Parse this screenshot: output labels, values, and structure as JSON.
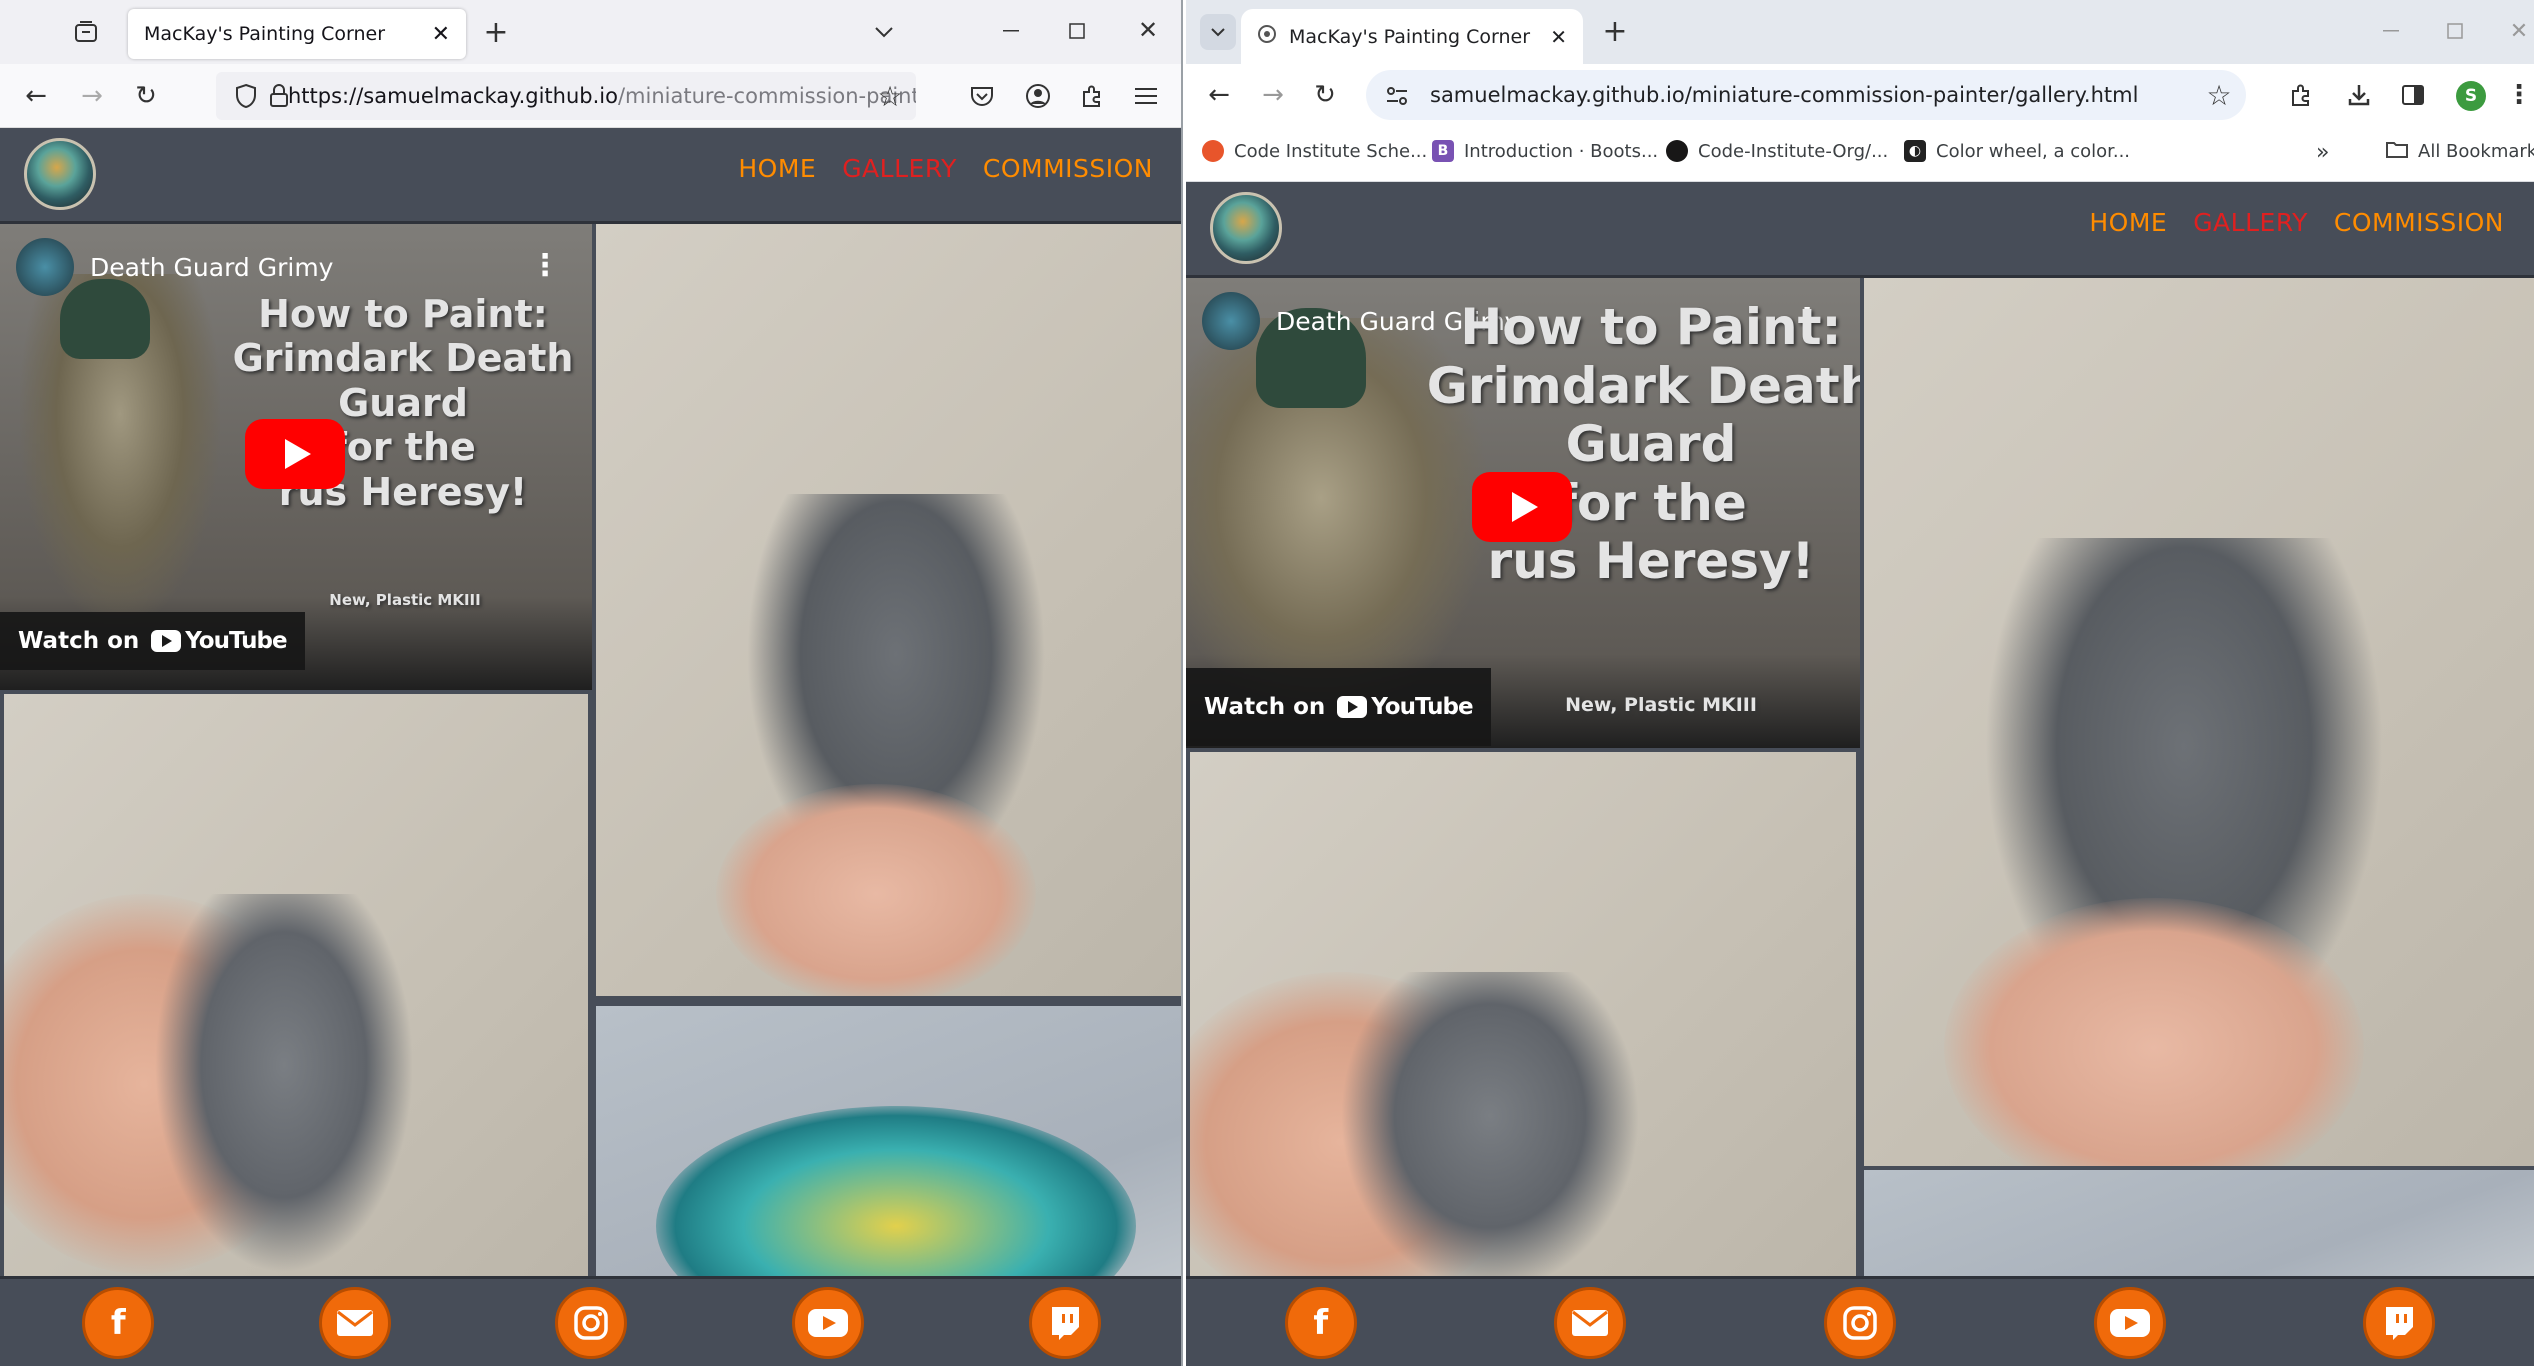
{
  "firefox": {
    "tab_title": "MacKay's Painting Corner",
    "url_domain": "https://samuelmackay.github.io",
    "url_path": "/miniature-commission-painte"
  },
  "chrome": {
    "tab_title": "MacKay's Painting Corner",
    "url_domain": "samuelmackay.github.io",
    "url_path": "/miniature-commission-painter/gallery.html",
    "profile_initial": "S",
    "bookmarks": [
      {
        "label": "Code Institute Sche...",
        "color": "#e8552b"
      },
      {
        "label": "Introduction · Boots...",
        "color": "#7952b3"
      },
      {
        "label": "Code-Institute-Org/...",
        "color": "#181717"
      },
      {
        "label": "Color wheel, a color...",
        "color": "#222222"
      }
    ],
    "all_bookmarks": "All Bookmarks",
    "more_bookmarks": "»"
  },
  "site": {
    "nav": {
      "home": "HOME",
      "gallery": "GALLERY",
      "commission": "COMMISSION"
    },
    "active_nav": "gallery",
    "video": {
      "channel_title": "Death Guard Grimy",
      "thumb_lines": [
        "How to Paint:",
        "Grimdark Death Guard",
        "for the",
        "rus Heresy!"
      ],
      "thumb_sub": "New, Plastic MKIII",
      "watch_on": "Watch on",
      "youtube": "YouTube"
    },
    "social": [
      "facebook",
      "email",
      "instagram",
      "youtube",
      "twitch"
    ],
    "accent_color": "#f06a0a",
    "header_color": "#474d58"
  }
}
